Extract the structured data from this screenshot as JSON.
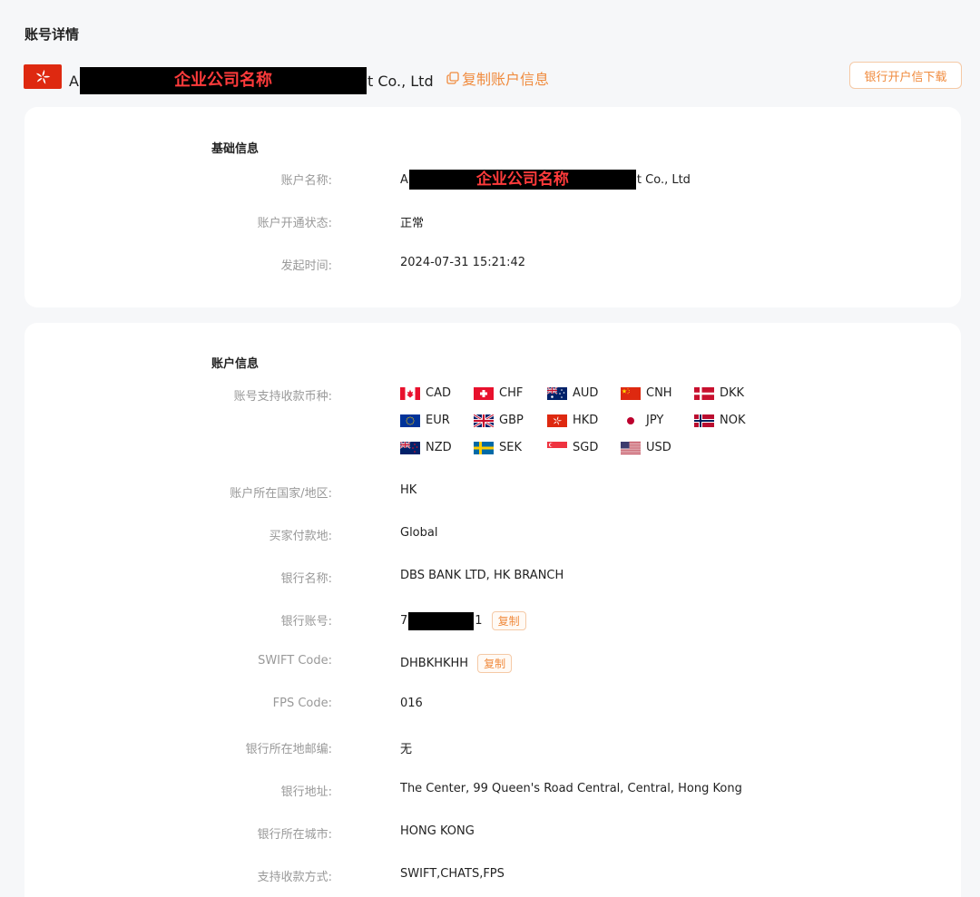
{
  "page": {
    "title": "账号详情"
  },
  "header": {
    "company_prefix": "A",
    "company_redaction_label": "企业公司名称",
    "company_suffix": "t Co., Ltd",
    "copy_account_label": "复制账户信息",
    "download_label": "银行开户信下载"
  },
  "basic_info": {
    "title": "基础信息",
    "rows": [
      {
        "label": "账户名称:",
        "prefix": "A",
        "redaction_label": "企业公司名称",
        "suffix": "t Co., Ltd"
      },
      {
        "label": "账户开通状态:",
        "value": "正常"
      },
      {
        "label": "发起时间:",
        "value": "2024-07-31 15:21:42"
      }
    ]
  },
  "account_info": {
    "title": "账户信息",
    "currencies_label": "账号支持收款币种:",
    "currencies": [
      {
        "code": "CAD",
        "flag": "canada-flag"
      },
      {
        "code": "CHF",
        "flag": "switzerland-flag"
      },
      {
        "code": "AUD",
        "flag": "australia-flag"
      },
      {
        "code": "CNH",
        "flag": "china-flag"
      },
      {
        "code": "DKK",
        "flag": "denmark-flag"
      },
      {
        "code": "EUR",
        "flag": "eu-flag"
      },
      {
        "code": "GBP",
        "flag": "uk-flag"
      },
      {
        "code": "HKD",
        "flag": "hong-kong-flag"
      },
      {
        "code": "JPY",
        "flag": "japan-flag"
      },
      {
        "code": "NOK",
        "flag": "norway-flag"
      },
      {
        "code": "NZD",
        "flag": "new-zealand-flag"
      },
      {
        "code": "SEK",
        "flag": "sweden-flag"
      },
      {
        "code": "SGD",
        "flag": "singapore-flag"
      },
      {
        "code": "USD",
        "flag": "usa-flag"
      }
    ],
    "rows": [
      {
        "label": "账户所在国家/地区:",
        "value": "HK"
      },
      {
        "label": "买家付款地:",
        "value": "Global"
      },
      {
        "label": "银行名称:",
        "value": "DBS BANK LTD, HK BRANCH"
      },
      {
        "label": "银行账号:",
        "prefix": "7",
        "suffix": "1",
        "copy_label": "复制"
      },
      {
        "label": "SWIFT Code:",
        "value": "DHBKHKHH",
        "copy_label": "复制"
      },
      {
        "label": "FPS Code:",
        "value": "016"
      },
      {
        "label": "银行所在地邮编:",
        "value": "无"
      },
      {
        "label": "银行地址:",
        "value": "The Center, 99 Queen's Road Central, Central, Hong Kong"
      },
      {
        "label": "银行所在城市:",
        "value": "HONG KONG"
      },
      {
        "label": "支持收款方式:",
        "value": "SWIFT,CHATS,FPS"
      }
    ]
  },
  "colors": {
    "accent": "#f08b3e",
    "label": "#999999",
    "text": "#222222",
    "background": "#f6f7f9"
  }
}
